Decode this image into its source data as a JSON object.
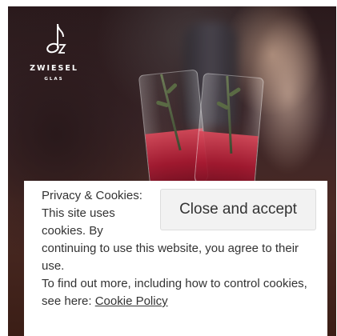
{
  "logo": {
    "brand": "ZWIESEL",
    "subtitle": "GLAS"
  },
  "photo": {
    "subject": "two stemless glasses with red drink and rosemary"
  },
  "cookie_banner": {
    "button_label": "Close and accept",
    "text_1": "Privacy & Cookies: This site uses cookies. By continuing to use this website, you agree to their use.",
    "text_2": "To find out more, including how to control cookies, see here:",
    "link_label": "Cookie Policy"
  }
}
